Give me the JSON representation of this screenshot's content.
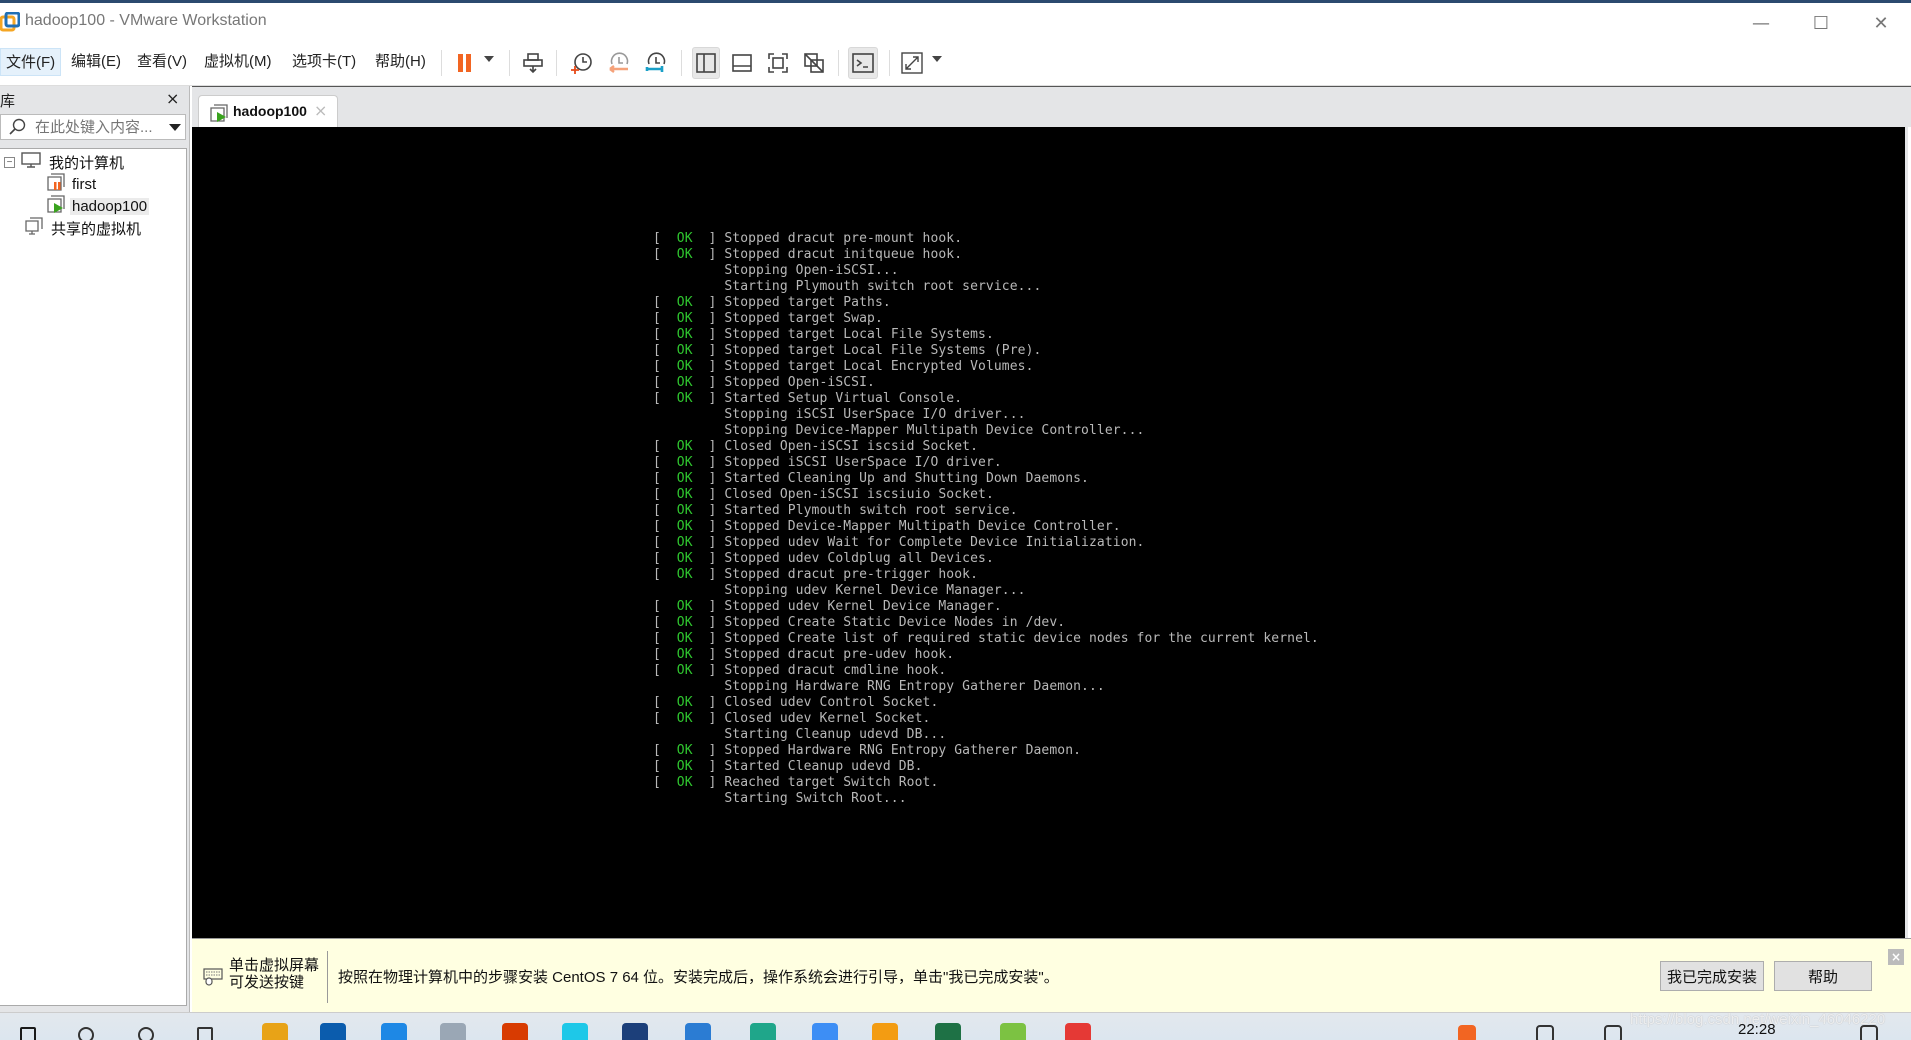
{
  "window": {
    "title": "hadoop100 - VMware Workstation",
    "controls": {
      "minimize": "—",
      "maximize": "☐",
      "close": "✕"
    }
  },
  "menu": [
    {
      "label": "文件(F)",
      "active": true
    },
    {
      "label": "编辑(E)"
    },
    {
      "label": "查看(V)"
    },
    {
      "label": "虚拟机(M)"
    },
    {
      "label": "选项卡(T)"
    },
    {
      "label": "帮助(H)"
    }
  ],
  "toolbar": {
    "buttons": [
      {
        "name": "pause-icon",
        "pressed": false
      },
      {
        "name": "send-ctrl-alt-del-icon",
        "pressed": false
      },
      {
        "name": "take-snapshot-icon",
        "pressed": false
      },
      {
        "name": "revert-snapshot-icon",
        "pressed": false
      },
      {
        "name": "snapshot-manager-icon",
        "pressed": false
      },
      {
        "name": "show-library-icon",
        "pressed": true
      },
      {
        "name": "thumbnail-bar-icon",
        "pressed": false
      },
      {
        "name": "full-screen-icon",
        "pressed": false
      },
      {
        "name": "unity-icon",
        "pressed": false
      },
      {
        "name": "console-view-icon",
        "pressed": true
      },
      {
        "name": "stretch-guest-icon",
        "pressed": false
      }
    ],
    "colors": {
      "pause": "#f26522",
      "revert": "#f5a27a",
      "manager": "#1aa0c8",
      "add": "#e64a19"
    }
  },
  "library": {
    "title": "库",
    "close": "×",
    "search_placeholder": "在此处键入内容...",
    "tree": [
      {
        "label": "我的计算机",
        "level": 0,
        "icon": "computer-icon",
        "toggle": "⊟"
      },
      {
        "label": "first",
        "level": 1,
        "icon": "vm-paused-icon"
      },
      {
        "label": "hadoop100",
        "level": 1,
        "icon": "vm-running-icon",
        "selected": true
      },
      {
        "label": "共享的虚拟机",
        "level": 0,
        "icon": "shared-vms-icon"
      }
    ]
  },
  "vm_tab": {
    "label": "hadoop100",
    "close": "×"
  },
  "console": {
    "lines": [
      {
        "ok": true,
        "text": "Stopped dracut pre-mount hook."
      },
      {
        "ok": true,
        "text": "Stopped dracut initqueue hook."
      },
      {
        "ok": false,
        "text": "Stopping Open-iSCSI..."
      },
      {
        "ok": false,
        "text": "Starting Plymouth switch root service..."
      },
      {
        "ok": true,
        "text": "Stopped target Paths."
      },
      {
        "ok": true,
        "text": "Stopped target Swap."
      },
      {
        "ok": true,
        "text": "Stopped target Local File Systems."
      },
      {
        "ok": true,
        "text": "Stopped target Local File Systems (Pre)."
      },
      {
        "ok": true,
        "text": "Stopped target Local Encrypted Volumes."
      },
      {
        "ok": true,
        "text": "Stopped Open-iSCSI."
      },
      {
        "ok": true,
        "text": "Started Setup Virtual Console."
      },
      {
        "ok": false,
        "text": "Stopping iSCSI UserSpace I/O driver..."
      },
      {
        "ok": false,
        "text": "Stopping Device-Mapper Multipath Device Controller..."
      },
      {
        "ok": true,
        "text": "Closed Open-iSCSI iscsid Socket."
      },
      {
        "ok": true,
        "text": "Stopped iSCSI UserSpace I/O driver."
      },
      {
        "ok": true,
        "text": "Started Cleaning Up and Shutting Down Daemons."
      },
      {
        "ok": true,
        "text": "Closed Open-iSCSI iscsiuio Socket."
      },
      {
        "ok": true,
        "text": "Started Plymouth switch root service."
      },
      {
        "ok": true,
        "text": "Stopped Device-Mapper Multipath Device Controller."
      },
      {
        "ok": true,
        "text": "Stopped udev Wait for Complete Device Initialization."
      },
      {
        "ok": true,
        "text": "Stopped udev Coldplug all Devices."
      },
      {
        "ok": true,
        "text": "Stopped dracut pre-trigger hook."
      },
      {
        "ok": false,
        "text": "Stopping udev Kernel Device Manager..."
      },
      {
        "ok": true,
        "text": "Stopped udev Kernel Device Manager."
      },
      {
        "ok": true,
        "text": "Stopped Create Static Device Nodes in /dev."
      },
      {
        "ok": true,
        "text": "Stopped Create list of required static device nodes for the current kernel."
      },
      {
        "ok": true,
        "text": "Stopped dracut pre-udev hook."
      },
      {
        "ok": true,
        "text": "Stopped dracut cmdline hook."
      },
      {
        "ok": false,
        "text": "Stopping Hardware RNG Entropy Gatherer Daemon..."
      },
      {
        "ok": true,
        "text": "Closed udev Control Socket."
      },
      {
        "ok": true,
        "text": "Closed udev Kernel Socket."
      },
      {
        "ok": false,
        "text": "Starting Cleanup udevd DB..."
      },
      {
        "ok": true,
        "text": "Stopped Hardware RNG Entropy Gatherer Daemon."
      },
      {
        "ok": true,
        "text": "Started Cleanup udevd DB."
      },
      {
        "ok": true,
        "text": "Reached target Switch Root."
      },
      {
        "ok": false,
        "text": "Starting Switch Root..."
      }
    ],
    "ok_label": "OK",
    "colors": {
      "text": "#b8b8b8",
      "ok": "#2fc62f",
      "background": "#000000"
    }
  },
  "hint_bar": {
    "click_hint_line1": "单击虚拟屏幕",
    "click_hint_line2": "可发送按键",
    "message": "按照在物理计算机中的步骤安装 CentOS 7 64 位。安装完成后，操作系统会进行引导，单击\"我已完成安装\"。",
    "done_button": "我已完成安装",
    "help_button": "帮助",
    "close": "×",
    "background": "#ffffe1"
  },
  "taskbar": {
    "clock": "22:28",
    "watermark": "https://blog.csdn.net/weixin_46046220",
    "apps": [
      {
        "name": "start-icon",
        "color": "#1a1a1a"
      },
      {
        "name": "search-icon",
        "color": "#333333"
      },
      {
        "name": "cortana-icon",
        "color": "#333333"
      },
      {
        "name": "task-view-icon",
        "color": "#333333"
      },
      {
        "name": "file-explorer-icon",
        "color": "#e8a317"
      },
      {
        "name": "app-blue-diamond-icon",
        "color": "#0b5cad"
      },
      {
        "name": "app-blue-circle-icon",
        "color": "#1e88e5"
      },
      {
        "name": "app-notepad-icon",
        "color": "#9aa7b5"
      },
      {
        "name": "office-icon",
        "color": "#d83b01"
      },
      {
        "name": "app-cyan-circle-icon",
        "color": "#1ec8e8"
      },
      {
        "name": "terminal-icon",
        "color": "#1c3f7a"
      },
      {
        "name": "word-icon",
        "color": "#2b7cd3"
      },
      {
        "name": "edge-icon",
        "color": "#1fa68a"
      },
      {
        "name": "app-blue-square-icon",
        "color": "#3d8ef5"
      },
      {
        "name": "app-orange-blue-icon",
        "color": "#f39c12"
      },
      {
        "name": "excel-icon",
        "color": "#1e7145"
      },
      {
        "name": "app-green-leaf-icon",
        "color": "#7cc242"
      },
      {
        "name": "chrome-icon",
        "color": "#e53935"
      }
    ],
    "tray": [
      {
        "name": "sogou-ime-icon",
        "color": "#f26522"
      },
      {
        "name": "tray-network-icon",
        "color": "#333333"
      },
      {
        "name": "tray-volume-icon",
        "color": "#333333"
      },
      {
        "name": "tray-notification-icon",
        "color": "#333333"
      }
    ]
  }
}
